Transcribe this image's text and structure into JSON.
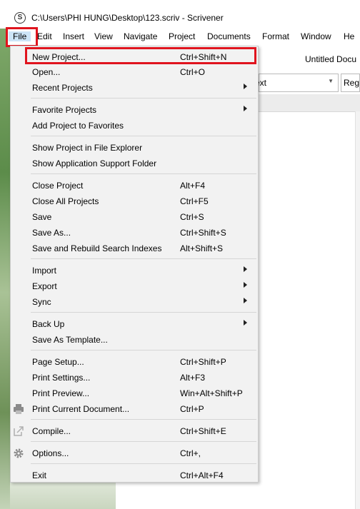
{
  "window": {
    "title": "C:\\Users\\PHI HUNG\\Desktop\\123.scriv - Scrivener",
    "app_icon": "scrivener-s-icon",
    "app_icon_glyph": "S"
  },
  "menubar": {
    "items": [
      "File",
      "Edit",
      "Insert",
      "View",
      "Navigate",
      "Project",
      "Documents",
      "Format",
      "Window",
      "He"
    ]
  },
  "toolbar": {
    "document_title": "Untitled Docu",
    "format_value": "ext",
    "format_value2": "Reg"
  },
  "highlight_color": "#e0141e",
  "file_menu": {
    "items": [
      {
        "label": "New Project...",
        "shortcut": "Ctrl+Shift+N"
      },
      {
        "label": "Open...",
        "shortcut": "Ctrl+O"
      },
      {
        "label": "Recent Projects",
        "shortcut": ""
      },
      {
        "label": "Favorite Projects",
        "shortcut": ""
      },
      {
        "label": "Add Project to Favorites",
        "shortcut": ""
      },
      {
        "label": "Show Project in File Explorer",
        "shortcut": ""
      },
      {
        "label": "Show Application Support Folder",
        "shortcut": ""
      },
      {
        "label": "Close Project",
        "shortcut": "Alt+F4"
      },
      {
        "label": "Close All Projects",
        "shortcut": "Ctrl+F5"
      },
      {
        "label": "Save",
        "shortcut": "Ctrl+S"
      },
      {
        "label": "Save As...",
        "shortcut": "Ctrl+Shift+S"
      },
      {
        "label": "Save and Rebuild Search Indexes",
        "shortcut": "Alt+Shift+S"
      },
      {
        "label": "Import",
        "shortcut": ""
      },
      {
        "label": "Export",
        "shortcut": ""
      },
      {
        "label": "Sync",
        "shortcut": ""
      },
      {
        "label": "Back Up",
        "shortcut": ""
      },
      {
        "label": "Save As Template...",
        "shortcut": ""
      },
      {
        "label": "Page Setup...",
        "shortcut": "Ctrl+Shift+P"
      },
      {
        "label": "Print Settings...",
        "shortcut": "Alt+F3"
      },
      {
        "label": "Print Preview...",
        "shortcut": "Win+Alt+Shift+P"
      },
      {
        "label": "Print Current Document...",
        "shortcut": "Ctrl+P"
      },
      {
        "label": "Compile...",
        "shortcut": "Ctrl+Shift+E"
      },
      {
        "label": "Options...",
        "shortcut": "Ctrl+,"
      },
      {
        "label": "Exit",
        "shortcut": "Ctrl+Alt+F4"
      }
    ],
    "icons": {
      "print": "printer-icon",
      "compile": "compile-icon",
      "options": "gear-icon"
    }
  }
}
